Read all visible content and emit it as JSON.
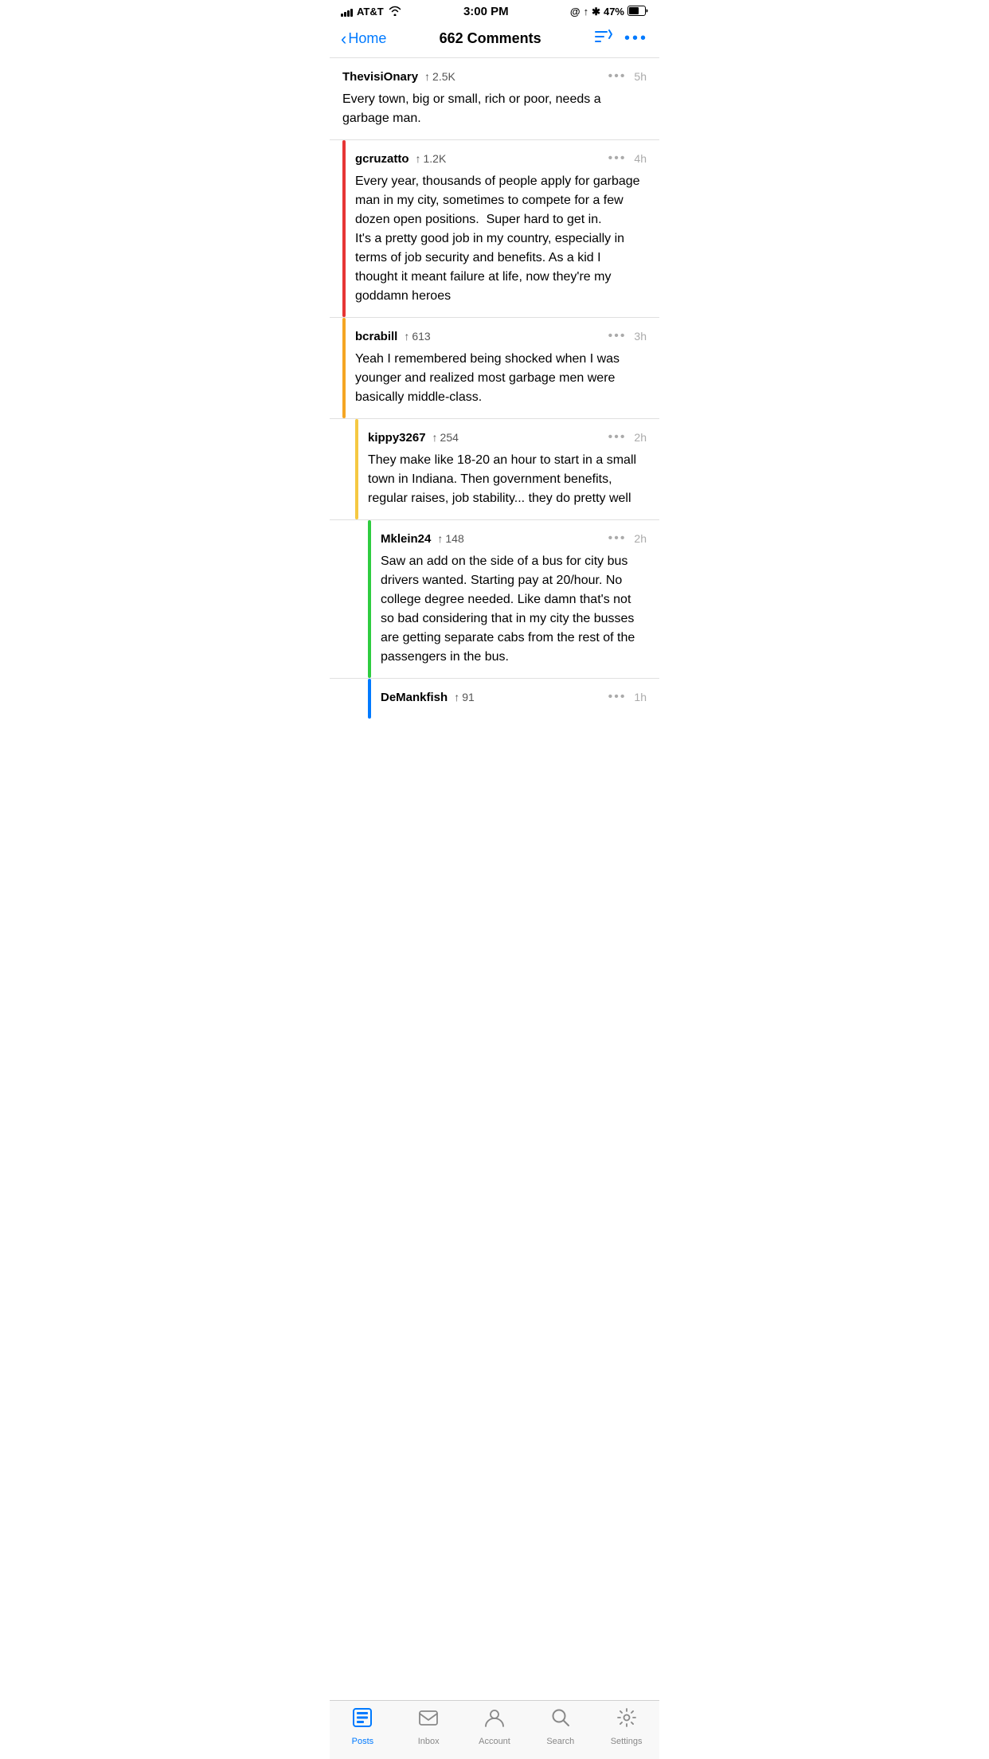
{
  "statusBar": {
    "carrier": "AT&T",
    "time": "3:00 PM",
    "location": "@",
    "navigation": "↑",
    "bluetooth": "✱",
    "battery": "47%"
  },
  "navBar": {
    "backLabel": "Home",
    "title": "662 Comments"
  },
  "comments": [
    {
      "id": "comment-1",
      "author": "ThevisiOnary",
      "upvotes": "2.5K",
      "time": "5h",
      "body": "Every town, big or small, rich or poor, needs a garbage man.",
      "indentLevel": 0,
      "barColor": null,
      "replies": []
    },
    {
      "id": "comment-2",
      "author": "gcruzatto",
      "upvotes": "1.2K",
      "time": "4h",
      "body": "Every year, thousands of people apply for garbage man in my city, sometimes to compete for a few dozen open positions.  Super hard to get in.\nIt's a pretty good job in my country, especially in terms of job security and benefits. As a kid I thought it meant failure at life, now they're my goddamn heroes",
      "indentLevel": 1,
      "barColor": "#e63535"
    },
    {
      "id": "comment-3",
      "author": "bcrabill",
      "upvotes": "613",
      "time": "3h",
      "body": "Yeah I remembered being shocked when I was younger and realized most garbage men were basically middle-class.",
      "indentLevel": 2,
      "barColor": "#f5a623"
    },
    {
      "id": "comment-4",
      "author": "kippy3267",
      "upvotes": "254",
      "time": "2h",
      "body": "They make like 18-20 an hour to start in a small town in Indiana. Then government benefits, regular raises, job stability... they do pretty well",
      "indentLevel": 3,
      "barColor": "#f5c842"
    },
    {
      "id": "comment-5",
      "author": "Mklein24",
      "upvotes": "148",
      "time": "2h",
      "body": "Saw an add on the side of a bus for city bus drivers wanted. Starting pay at 20/hour. No college degree needed. Like damn that's not so bad considering that in my city the busses are getting separate cabs from the rest of the passengers in the bus.",
      "indentLevel": 4,
      "barColor": "#2ecc40"
    },
    {
      "id": "comment-6",
      "author": "DeMankfish",
      "upvotes": "91",
      "time": "1h",
      "body": "",
      "indentLevel": 4,
      "barColor": "#007aff",
      "partial": true
    }
  ],
  "tabBar": {
    "items": [
      {
        "id": "posts",
        "label": "Posts",
        "icon": "posts",
        "active": true
      },
      {
        "id": "inbox",
        "label": "Inbox",
        "icon": "inbox",
        "active": false
      },
      {
        "id": "account",
        "label": "Account",
        "icon": "account",
        "active": false
      },
      {
        "id": "search",
        "label": "Search",
        "icon": "search",
        "active": false
      },
      {
        "id": "settings",
        "label": "Settings",
        "icon": "settings",
        "active": false
      }
    ]
  }
}
